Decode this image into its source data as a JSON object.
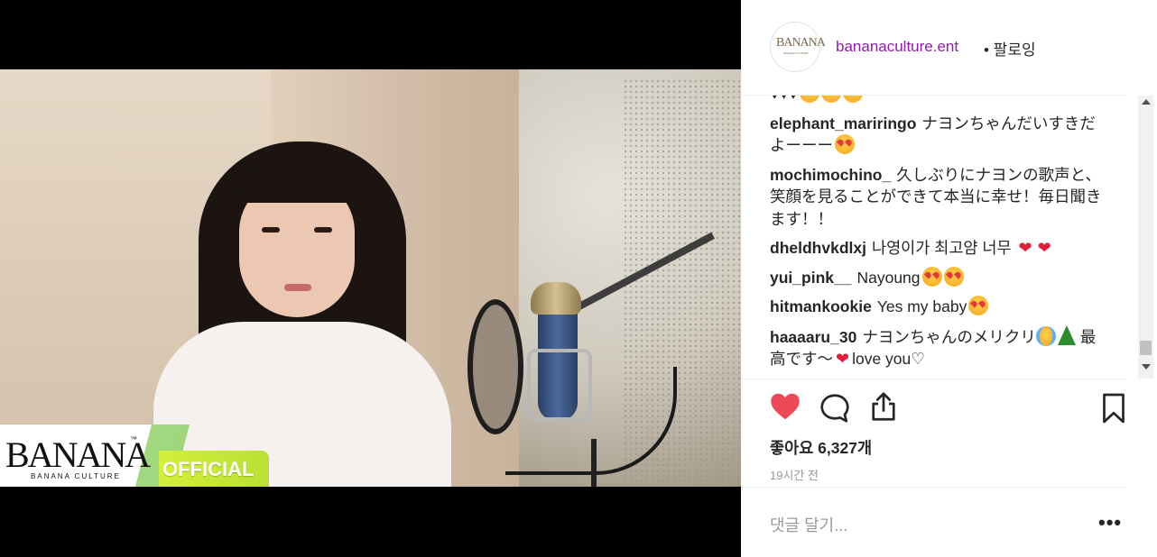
{
  "media": {
    "logo_text": "BANANA",
    "logo_tm": "™",
    "logo_sub": "BANANA CULTURE",
    "official_label": "OFFICIAL"
  },
  "header": {
    "avatar_text": "BANANA",
    "avatar_sub": "BANANA CULTURE",
    "account": "bananaculture.ent",
    "follow_label": "• 팔로잉"
  },
  "comments": [
    {
      "user": "",
      "text": "♥♥♥",
      "emojis": [
        "heart-eyes-emoji",
        "heart-eyes-emoji",
        "heart-eyes-emoji"
      ]
    },
    {
      "user": "elephant_mariringo",
      "text": "ナヨンちゃんだいすきだよーーー",
      "emojis": [
        "heart-eyes-emoji"
      ]
    },
    {
      "user": "mochimochino_",
      "text": "久しぶりにナヨンの歌声と、笑顔を見ることができて本当に幸せ！毎日聞きます！！"
    },
    {
      "user": "dheldhvkdlxj",
      "text": "나영이가 최고얌 너무"
    },
    {
      "user": "yui_pink__",
      "text": "Nayoung"
    },
    {
      "user": "hitmankookie",
      "text": "Yes my baby"
    },
    {
      "user": "haaaaru_30",
      "text": "ナヨンちゃんのメリクリ",
      "text2": "最高です～",
      "text3": "love you♡"
    }
  ],
  "actions": {
    "likes": "좋아요 6,327개",
    "time": "19시간 전"
  },
  "add_comment": {
    "placeholder": "댓글 달기...",
    "more": "•••"
  },
  "colors": {
    "account": "#8f1bb0",
    "like": "#ed4956",
    "border": "#efefef"
  }
}
